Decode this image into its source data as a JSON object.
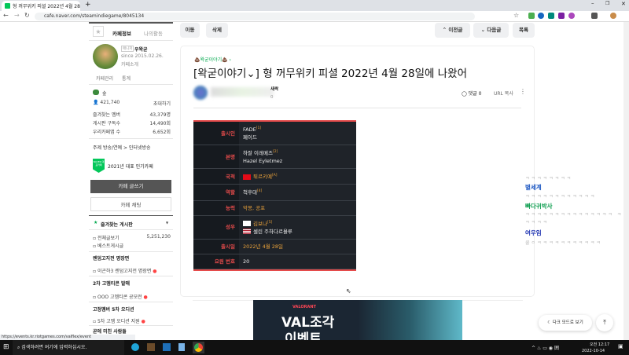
{
  "browser": {
    "tab_title": "형 꺼무위키 피셜 2022년 4월 28",
    "url": "cafe.naver.com/steamindiegame/8045134",
    "status_url": "https://events.kr.riotgames.com/valflex/event"
  },
  "sidebar": {
    "tab_info": "카페정보",
    "tab_activity": "나의활동",
    "manager_badge": "매니저",
    "manager": "우왁굳",
    "since": "since 2015.02.26.",
    "intro": "카페소개",
    "manage": "카페관리",
    "stats": "통계",
    "level": "숲",
    "members": "421,740",
    "invite": "초대하기",
    "stats_rows": [
      {
        "label": "즐겨찾는 멤버",
        "value": "43,379명"
      },
      {
        "label": "게시판 구독수",
        "value": "14,490회"
      },
      {
        "label": "우리카페앱 수",
        "value": "6,652회"
      }
    ],
    "topic": "주제 방송/연예 > 인터넷방송",
    "badge_text": "NAVER 대표카페",
    "award": "2021년 대표 인기카페",
    "write": "카페 글쓰기",
    "chat": "카페 채팅",
    "fav_boards": "즐겨찾는 게시판",
    "boards": [
      {
        "label": "전체글보기",
        "count": "5,251,230"
      },
      {
        "label": "베스트게시글"
      },
      {
        "label": "렌덤고지전 명장면",
        "header": true
      },
      {
        "label": "이곤하3 렌덤고지전 명장면",
        "new": true
      },
      {
        "label": "2차 고멤티콘 발매",
        "header": true
      },
      {
        "label": "OOO 고멤티콘 공모전",
        "new": true
      },
      {
        "label": "고정멤버 5차 오디션",
        "header": true
      },
      {
        "label": "5차 고멤 오디션 지원",
        "new": true
      },
      {
        "label": "곧에 미친 사람들",
        "header": true
      }
    ]
  },
  "toolbar": {
    "move": "이동",
    "delete": "삭제",
    "prev": "이전글",
    "next": "다음글",
    "list": "목록"
  },
  "article": {
    "category": "왁굳이야기",
    "title": "[왁굳이야기⌄] 형 꺼무위키 피셜 2022년 4월 28일에 나왔어",
    "author_tag": "새싹",
    "views": "0",
    "comments": "댓글 0",
    "url_copy": "URL 복사",
    "infobox": [
      {
        "label": "출시인",
        "lines": [
          "FADE",
          "페이드"
        ],
        "sup": "[1]"
      },
      {
        "label": "본명",
        "lines": [
          "하잘 이레메즈",
          "Hazel Eyletmez"
        ],
        "sup": "[2]"
      },
      {
        "label": "국적",
        "lines": [
          "튀르키예"
        ],
        "sup": "[A]"
      },
      {
        "label": "역할",
        "lines": [
          "척후대"
        ],
        "sup": "[4]"
      },
      {
        "label": "능력",
        "lines": [
          "악몽, 공포"
        ]
      },
      {
        "label": "성우",
        "lines": [
          "김보나",
          "셀린 주하다르욜루"
        ],
        "sup": "[5]"
      },
      {
        "label": "출시일",
        "lines": [
          "2022년 4월 28일"
        ]
      },
      {
        "label": "요원 번호",
        "lines": [
          "20"
        ]
      }
    ]
  },
  "ad": {
    "brand": "VALORANT",
    "headline1": "VAL조각",
    "headline2": "이벤트"
  },
  "comments": [
    {
      "name": "별세계",
      "text": "ㅋㅋㅋㅋㅋㅋㅋㅋㅋㅋㅋㅋ"
    },
    {
      "name": "빠다귀박사",
      "text": "ㅋㅋㅋㅋㅋㅋㅋㅋㅋㅋㅋㅋㅋㅋㅋ ㅋㅋㅋㅋㅋ"
    },
    {
      "name": "여우임",
      "text": "쿨ㅇㅋㅋㅋㅋㅋㅋㅋㅋㅋㅋㅋ"
    }
  ],
  "floating": {
    "dark_mode": "다크 모드로 보기"
  },
  "taskbar": {
    "search": "검색하려면 여기에 입력하십시오.",
    "time": "오전 12:17",
    "date": "2022-10-14"
  }
}
